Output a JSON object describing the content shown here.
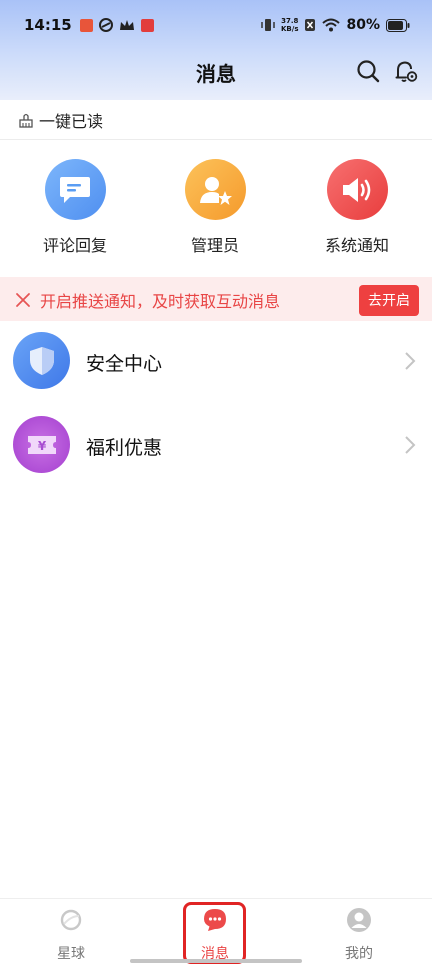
{
  "status_bar": {
    "time": "14:15",
    "net_speed_top": "37.8",
    "net_speed_unit": "KB/s",
    "battery": "80%"
  },
  "header": {
    "title": "消息",
    "search_icon": "search-icon",
    "notify_settings_icon": "bell-settings-icon"
  },
  "read_all": {
    "label": "一键已读",
    "icon": "broom-icon"
  },
  "categories": [
    {
      "label": "评论回复",
      "icon": "comment-icon",
      "color": "#5aa0f5"
    },
    {
      "label": "管理员",
      "icon": "admin-star-icon",
      "color": "#f8aa3c"
    },
    {
      "label": "系统通知",
      "icon": "speaker-icon",
      "color": "#f05050"
    }
  ],
  "push_banner": {
    "text": "开启推送通知，及时获取互动消息",
    "button": "去开启",
    "accent": "#ee4040"
  },
  "rows": [
    {
      "label": "安全中心",
      "icon": "shield-icon",
      "color": "#4a86ef"
    },
    {
      "label": "福利优惠",
      "icon": "coupon-icon",
      "color": "#b353d6"
    }
  ],
  "tabs": [
    {
      "label": "星球",
      "icon": "planet-icon",
      "active": false
    },
    {
      "label": "消息",
      "icon": "message-icon",
      "active": true
    },
    {
      "label": "我的",
      "icon": "profile-icon",
      "active": false
    }
  ]
}
